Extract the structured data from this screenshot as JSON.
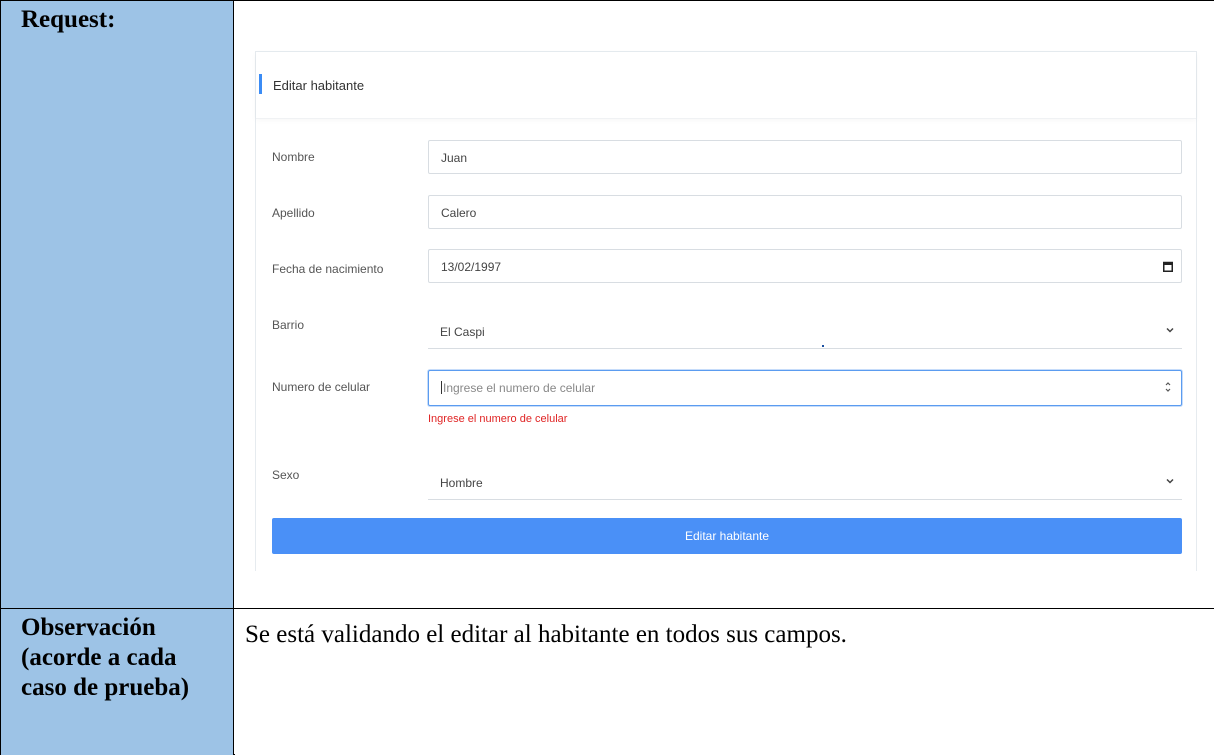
{
  "table": {
    "request_label": "Request:",
    "observation_label": "Observación (acorde a cada caso de prueba)",
    "observation_text": "Se está validando el editar al habitante en todos sus campos."
  },
  "form": {
    "header_title": "Editar habitante",
    "fields": [
      {
        "label": "Nombre",
        "value": "Juan",
        "type": "text"
      },
      {
        "label": "Apellido",
        "value": "Calero",
        "type": "text"
      },
      {
        "label": "Fecha de nacimiento",
        "value": "13/02/1997",
        "type": "date",
        "icon": "calendar-icon"
      },
      {
        "label": "Barrio",
        "value": "El Caspi",
        "type": "select",
        "icon": "chevron-down-icon"
      },
      {
        "label": "Numero de celular",
        "value": "",
        "placeholder": "Ingrese el numero de celular",
        "type": "number",
        "icon": "spinner-icon",
        "error": "Ingrese el numero de celular"
      },
      {
        "label": "Sexo",
        "value": "Hombre",
        "type": "select",
        "icon": "chevron-down-icon"
      }
    ],
    "submit_label": "Editar habitante"
  },
  "colors": {
    "label_cell_bg": "#9dc3e6",
    "accent": "#3b8cf5",
    "button_bg": "#4a90f7",
    "error": "#e02424"
  }
}
